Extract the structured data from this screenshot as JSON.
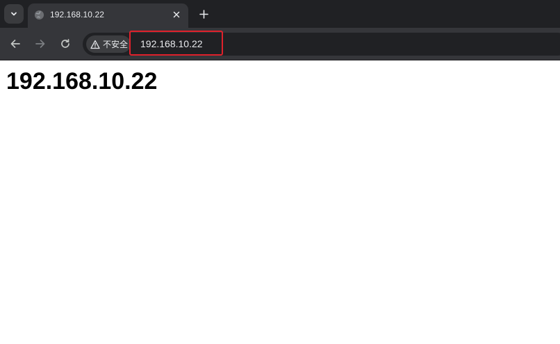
{
  "browser": {
    "tab": {
      "title": "192.168.10.22",
      "favicon": "globe-icon"
    },
    "toolbar": {
      "security_label": "不安全",
      "url": "192.168.10.22"
    }
  },
  "page": {
    "heading": "192.168.10.22"
  },
  "colors": {
    "tabstrip": "#202124",
    "toolbar": "#35363a",
    "omnibox": "#202124",
    "highlight": "#e0212b"
  }
}
